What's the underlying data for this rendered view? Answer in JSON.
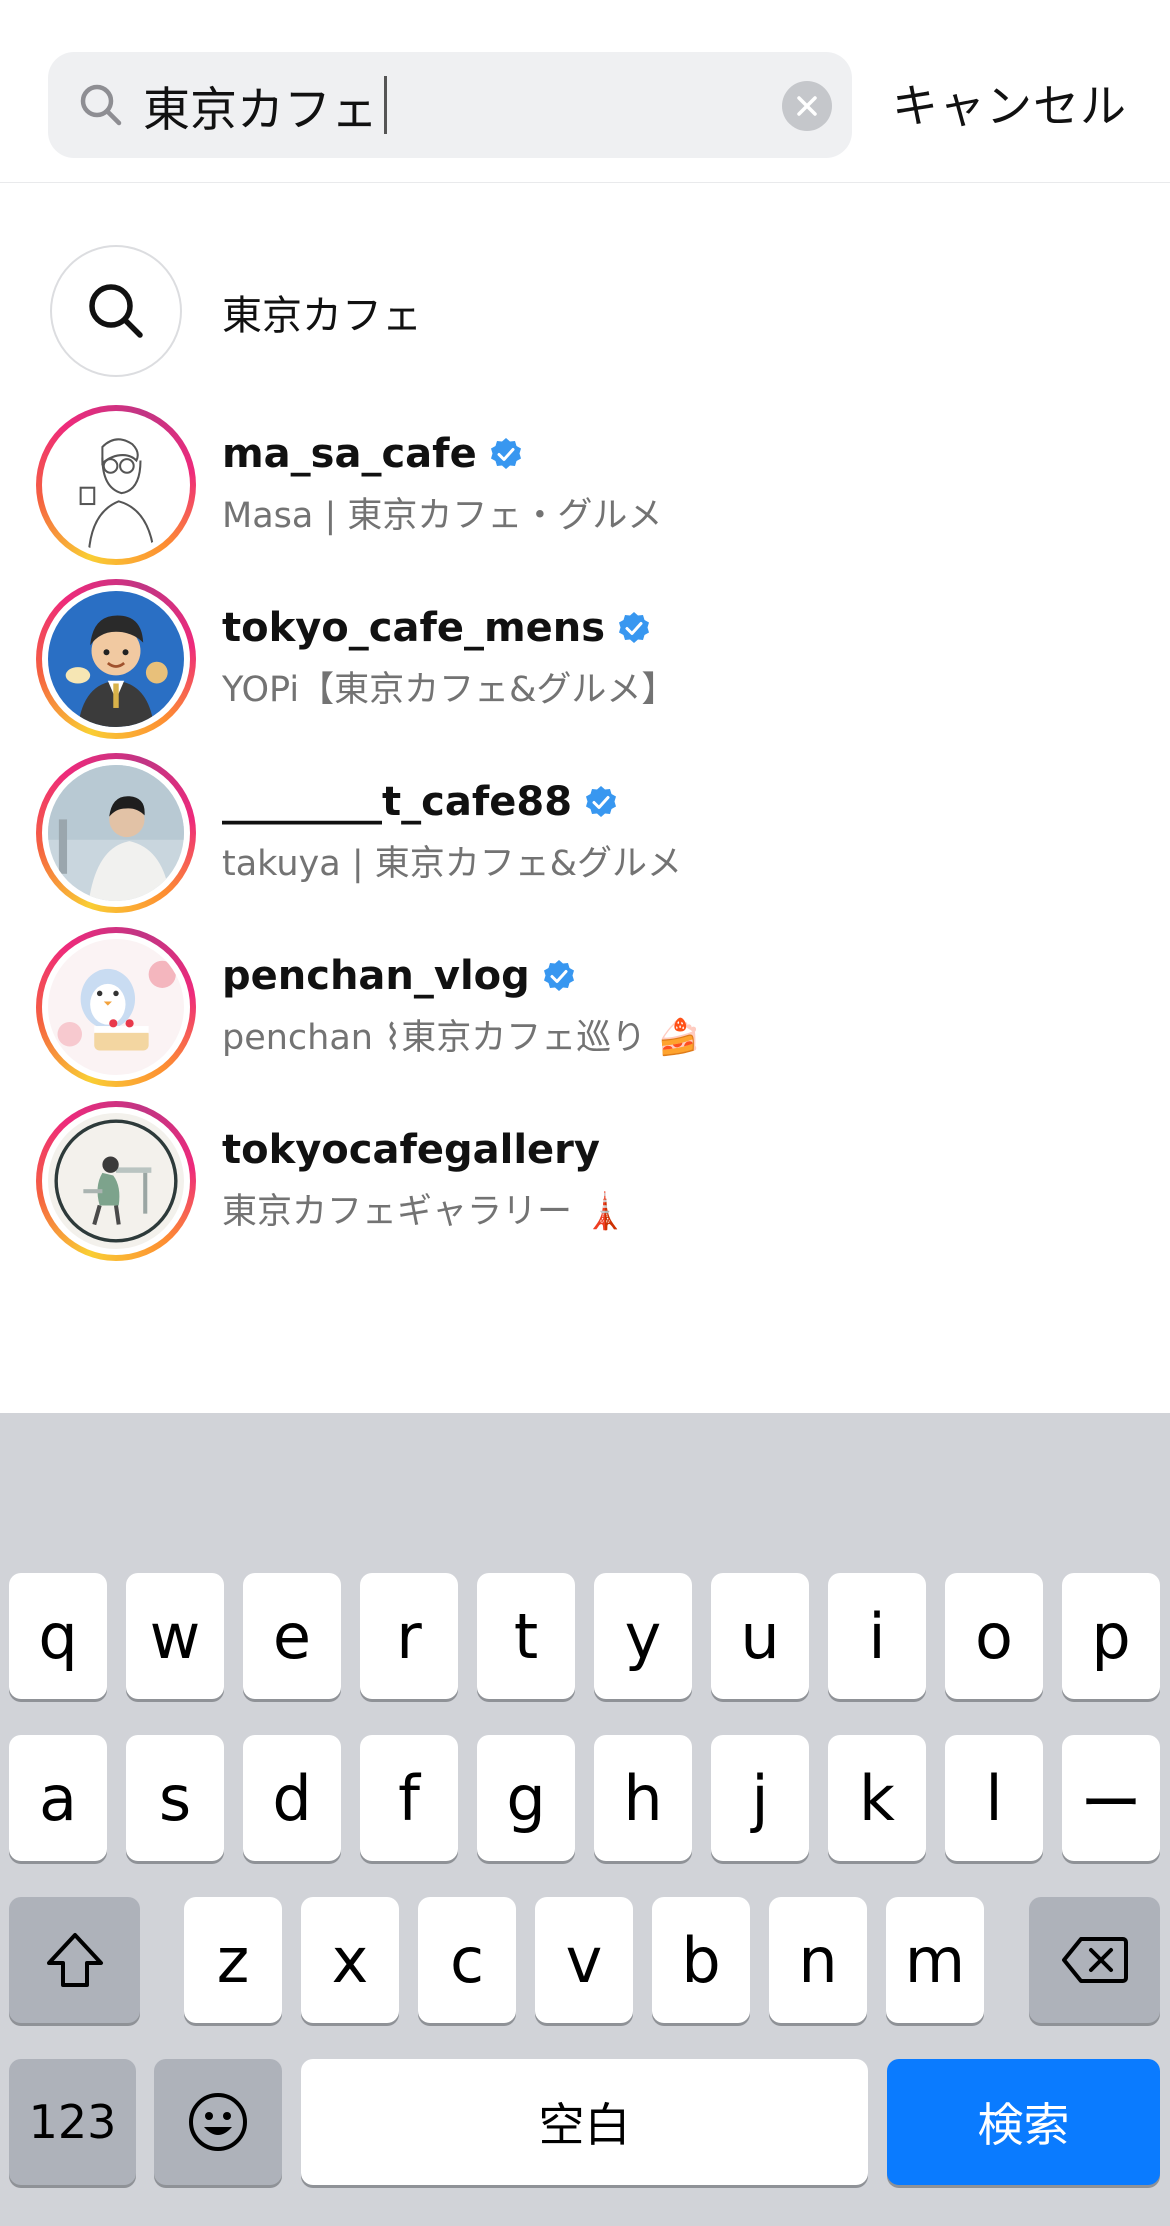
{
  "search": {
    "query": "東京カフェ",
    "cancel_label": "キャンセル"
  },
  "keyword_suggestion": "東京カフェ",
  "accounts": [
    {
      "username": "ma_sa_cafe",
      "name": "Masa | 東京カフェ・グルメ",
      "verified": true
    },
    {
      "username": "tokyo_cafe_mens",
      "name": "YOPi【東京カフェ&グルメ】",
      "verified": true
    },
    {
      "username": "________t_cafe88",
      "name": "takuya | 東京カフェ&グルメ",
      "verified": true
    },
    {
      "username": "penchan_vlog",
      "name": "penchan ⌇東京カフェ巡り 🍰",
      "verified": true
    },
    {
      "username": "tokyocafegallery",
      "name": "東京カフェギャラリー 🗼",
      "verified": false
    }
  ],
  "keyboard": {
    "row1": [
      "q",
      "w",
      "e",
      "r",
      "t",
      "y",
      "u",
      "i",
      "o",
      "p"
    ],
    "row2": [
      "a",
      "s",
      "d",
      "f",
      "g",
      "h",
      "j",
      "k",
      "l",
      "ー"
    ],
    "row3": [
      "z",
      "x",
      "c",
      "v",
      "b",
      "n",
      "m"
    ],
    "numbers_label": "123",
    "space_label": "空白",
    "search_label": "検索"
  },
  "colors": {
    "verified_blue": "#3897f0",
    "key_blue": "#0a7bff",
    "keyboard_bg": "#d1d3d8"
  }
}
